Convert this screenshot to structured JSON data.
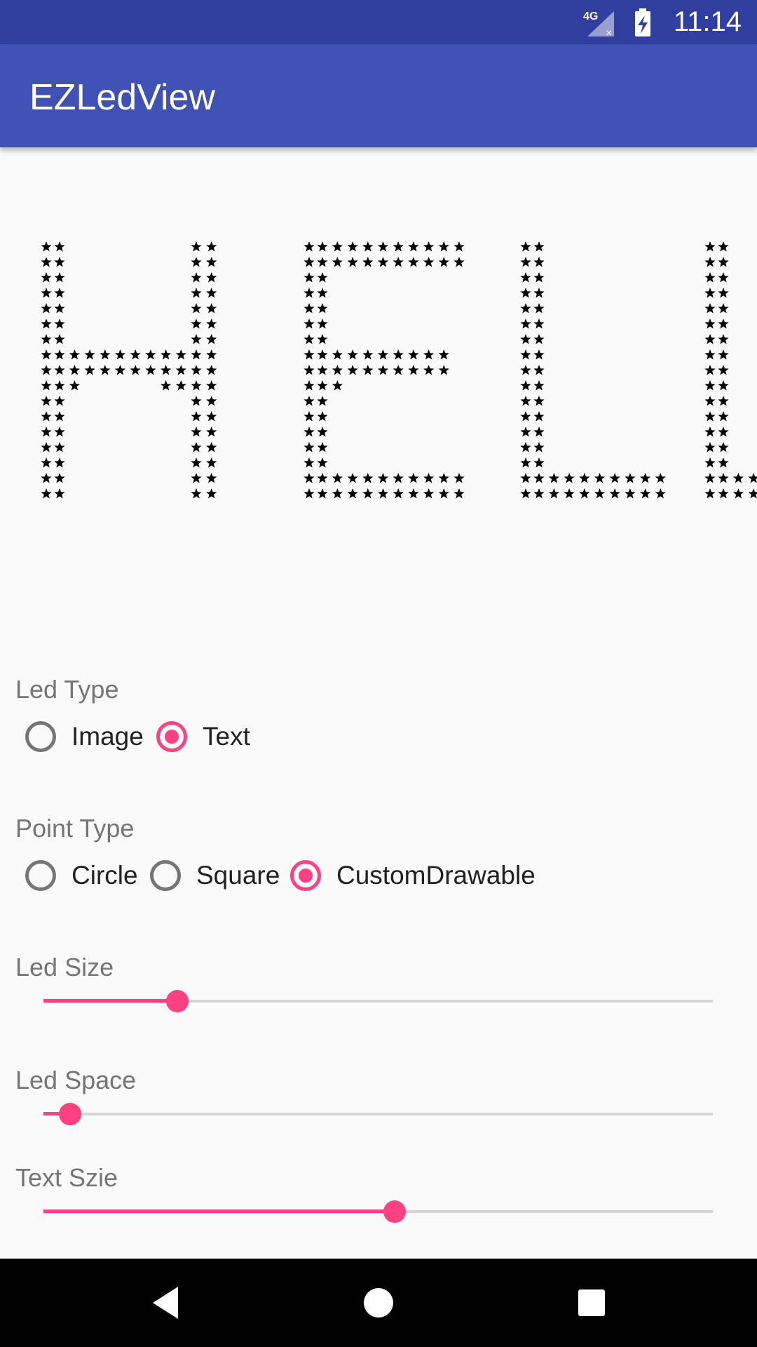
{
  "status_bar": {
    "network": "4G",
    "time": "11:14"
  },
  "app_bar": {
    "title": "EZLedView"
  },
  "led_view": {
    "text": "HELLO",
    "led_type": "Text",
    "point_type": "CustomDrawable",
    "point_icon": "star-icon"
  },
  "controls": {
    "led_type": {
      "label": "Led Type",
      "options": [
        "Image",
        "Text"
      ],
      "selected": "Text"
    },
    "point_type": {
      "label": "Point Type",
      "options": [
        "Circle",
        "Square",
        "CustomDrawable"
      ],
      "selected": "CustomDrawable"
    },
    "led_size": {
      "label": "Led Size",
      "progress": 0.2
    },
    "led_space": {
      "label": "Led Space",
      "progress": 0.04
    },
    "text_size": {
      "label": "Text Szie",
      "progress": 0.525
    }
  },
  "colors": {
    "primary": "#3f51b5",
    "primary_dark": "#303f9f",
    "accent": "#ff4081"
  },
  "nav_bar": {
    "buttons": [
      "back-icon",
      "home-icon",
      "recents-icon"
    ]
  }
}
